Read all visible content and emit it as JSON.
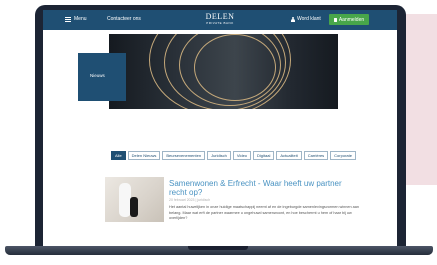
{
  "nav": {
    "menu_label": "Menu",
    "contact_label": "Contacteer ons",
    "logo_main": "DELEN",
    "logo_sub": "PRIVATE BANK",
    "client_label": "Word klant",
    "login_label": "Aanmelden"
  },
  "hero": {
    "box_label": "Nieuws"
  },
  "tabs": [
    "Alle",
    "Delen Nieuws",
    "Beursevenementen",
    "Juridisch",
    "Video",
    "Digitaal",
    "Actualiteit",
    "Carrières",
    "Corporate"
  ],
  "article": {
    "title": "Samenwonen & Erfrecht - Waar heeft uw partner recht op?",
    "date": "20 februari 2023 | juridisch",
    "text": "Het aantal huwelijken in onze huidige maatschappij neemt af en de ingeburgde samenlevingsvormen winnen aan belang. Maar wat erft de partner waarmee u ongehuwd samenwoont, en hoe beschermt u hem of haar bij uw overlijden?"
  },
  "colors": {
    "brand_blue": "#1f4f73",
    "login_green": "#48a64a",
    "link_blue": "#4a93c2"
  }
}
